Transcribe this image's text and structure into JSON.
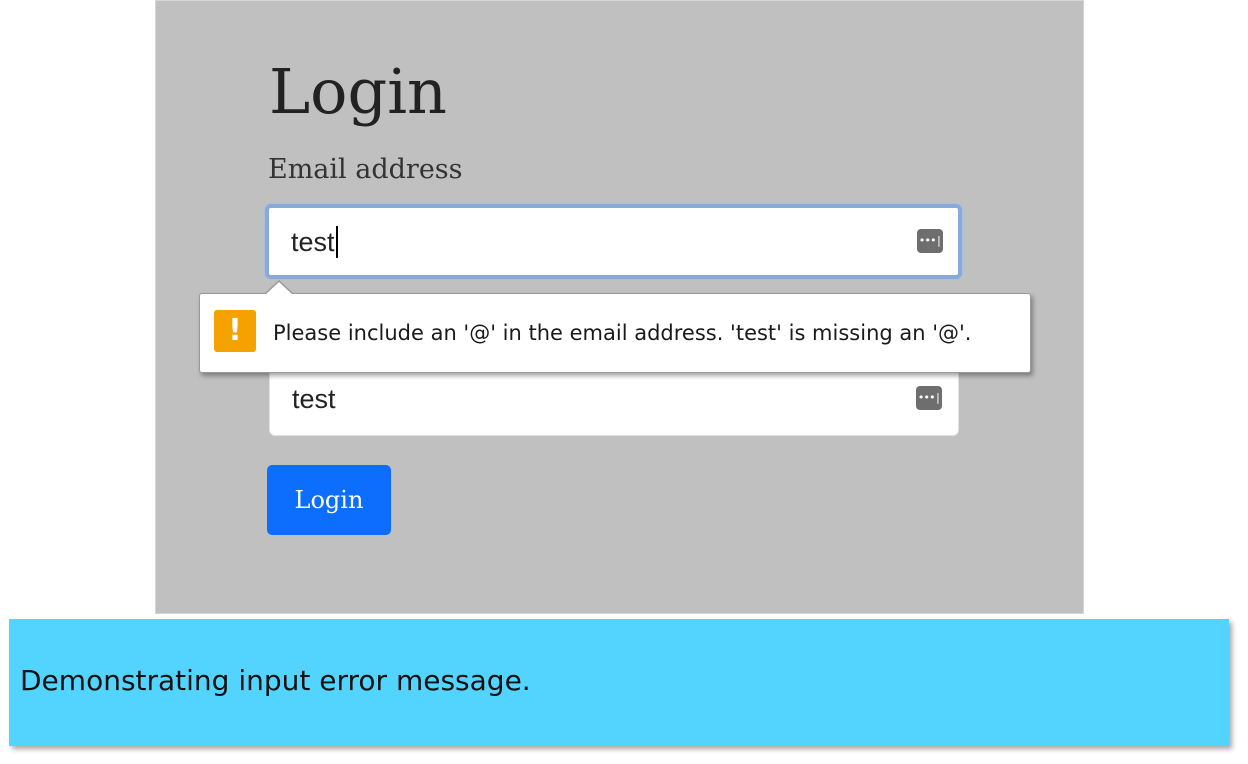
{
  "form": {
    "title": "Login",
    "email_label": "Email address",
    "email_value": "test",
    "password_value": "test",
    "submit_label": "Login"
  },
  "icons": {
    "password_manager": "password-manager-icon",
    "warning": "warning-icon"
  },
  "validation_tooltip": {
    "icon_glyph": "!",
    "message": "Please include an '@' in the email address. 'test' is missing an '@'."
  },
  "caption": {
    "text": "Demonstrating input error message."
  },
  "colors": {
    "panel_background": "#c0c0c0",
    "button_primary": "#0d6efd",
    "warning": "#f5a100",
    "caption_background": "#53d4fe",
    "focus_ring": "#8aa9d6"
  }
}
